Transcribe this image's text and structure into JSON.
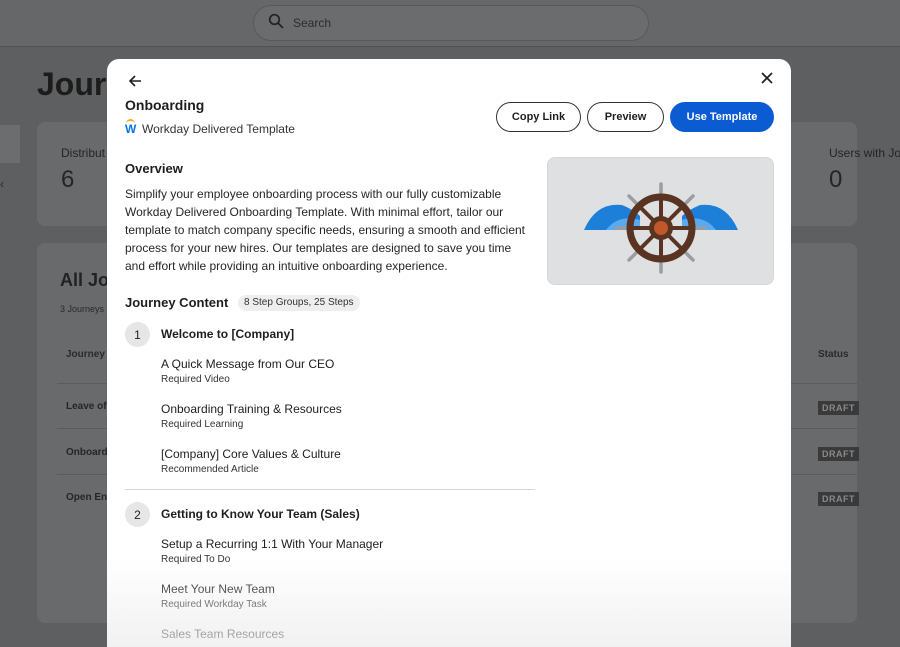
{
  "search": {
    "placeholder": "Search"
  },
  "page": {
    "title": "Journ",
    "stats": [
      {
        "label": "Distribut",
        "value": "6"
      },
      {
        "label": "Users with Jo",
        "value": "0"
      }
    ],
    "section_title": "All Jo",
    "section_sub": "3 Journeys",
    "columns": {
      "journey": "Journey",
      "status": "Status"
    },
    "rows": [
      {
        "name": "Leave of",
        "status": "DRAFT"
      },
      {
        "name": "Onboard",
        "status": "DRAFT"
      },
      {
        "name": "Open En",
        "status": "DRAFT"
      }
    ]
  },
  "modal": {
    "title": "Onboarding",
    "subtitle": "Workday Delivered Template",
    "logo_letter": "W",
    "buttons": {
      "copy_link": "Copy Link",
      "preview": "Preview",
      "use_template": "Use Template"
    },
    "overview_heading": "Overview",
    "overview_text": "Simplify your employee onboarding process with our fully customizable Workday Delivered Onboarding Template. With minimal effort, tailor our template to match company specific needs, ensuring a smooth and efficient process for your new hires. Our templates are designed to save you time and effort while providing an intuitive onboarding experience.",
    "journey_content_heading": "Journey Content",
    "journey_content_badge": "8 Step Groups, 25 Steps",
    "groups": [
      {
        "number": "1",
        "title": "Welcome to [Company]",
        "steps": [
          {
            "title": "A Quick Message from Our CEO",
            "type": "Required Video"
          },
          {
            "title": "Onboarding Training & Resources",
            "type": "Required Learning"
          },
          {
            "title": "[Company] Core Values & Culture",
            "type": "Recommended Article"
          }
        ]
      },
      {
        "number": "2",
        "title": "Getting to Know Your Team (Sales)",
        "steps": [
          {
            "title": "Setup a Recurring 1:1 With Your Manager",
            "type": "Required To Do"
          },
          {
            "title": "Meet Your New Team",
            "type": "Required Workday Task"
          },
          {
            "title": "Sales Team Resources",
            "type": ""
          }
        ]
      }
    ]
  },
  "colors": {
    "primary": "#0b5bd3",
    "workday_blue": "#0875e1",
    "workday_orange": "#f5a623",
    "wheel_brown": "#5a3422",
    "wheel_center": "#c0582a",
    "wave_blue": "#1e7fd8"
  },
  "icons": [
    "search-icon",
    "back-arrow-icon",
    "close-icon",
    "ship-wheel-illustration",
    "workday-logo-icon",
    "collapse-chevron-icon"
  ]
}
